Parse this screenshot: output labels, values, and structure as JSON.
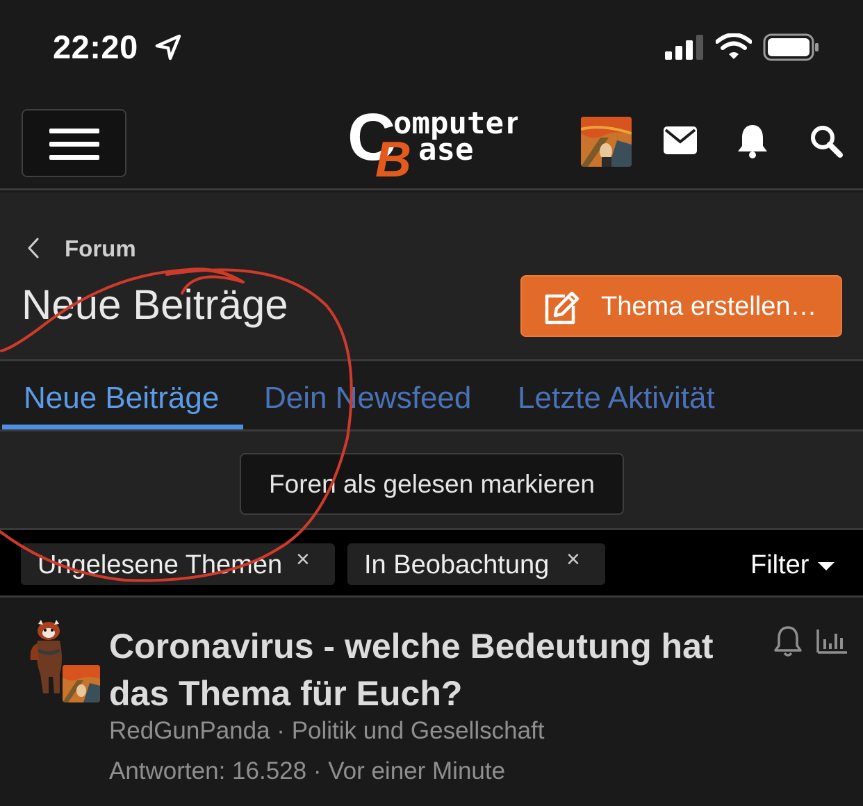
{
  "status_bar": {
    "time": "22:20"
  },
  "header": {
    "logo_text_line1": "omputer",
    "logo_text_line2": "ase",
    "logo_letter_c": "C",
    "logo_letter_b": "B",
    "brand_color": "#e35a1e"
  },
  "breadcrumb": {
    "label": "Forum"
  },
  "page": {
    "title": "Neue Beiträge",
    "create_button": "Thema erstellen…"
  },
  "tabs": [
    {
      "label": "Neue Beiträge",
      "active": true
    },
    {
      "label": "Dein Newsfeed",
      "active": false
    },
    {
      "label": "Letzte Aktivität",
      "active": false
    }
  ],
  "mark_read_button": "Foren als gelesen markieren",
  "filters": {
    "chips": [
      {
        "label": "Ungelesene Themen",
        "remove": "×"
      },
      {
        "label": "In Beobachtung",
        "remove": "×"
      }
    ],
    "filter_button": "Filter"
  },
  "thread": {
    "title": "Coronavirus - welche Bedeutung hat das Thema für Euch?",
    "author": "RedGunPanda",
    "forum": "Politik und Gesellschaft",
    "replies": "Antworten: 16.528",
    "last_post": "Vor einer Minute",
    "separator": " · "
  },
  "colors": {
    "accent_orange": "#e36b2a",
    "tab_blue": "#5b9be8",
    "annotation_red": "#d13a2a"
  }
}
